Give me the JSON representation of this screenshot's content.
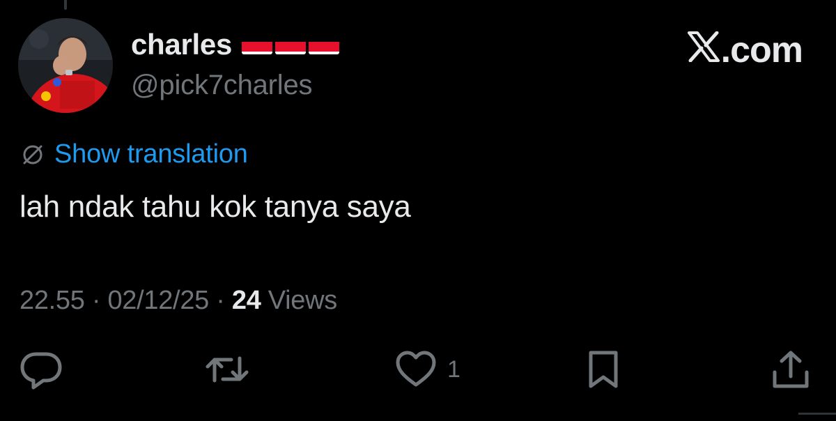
{
  "author": {
    "display_name": "charles",
    "flags": [
      "flag-indonesia",
      "flag-indonesia",
      "flag-indonesia"
    ],
    "handle": "@pick7charles"
  },
  "brand": {
    "text": ".com",
    "logo": "x-logo"
  },
  "translation": {
    "label": "Show translation",
    "icon": "globe-translate-icon"
  },
  "tweet": {
    "text": "lah ndak tahu kok tanya saya"
  },
  "meta": {
    "time": "22.55",
    "separator": " · ",
    "date": "02/12/25",
    "views_count": "24",
    "views_label": " Views"
  },
  "actions": {
    "reply": {
      "icon": "reply-icon"
    },
    "repost": {
      "icon": "repost-icon"
    },
    "like": {
      "icon": "heart-icon",
      "count": "1"
    },
    "bookmark": {
      "icon": "bookmark-icon"
    },
    "share": {
      "icon": "share-icon"
    }
  },
  "colors": {
    "background": "#000000",
    "primary_text": "#e7e9ea",
    "secondary_text": "#71767b",
    "link": "#1d9bf0",
    "flag_red": "#e8112d",
    "flag_white": "#ffffff"
  }
}
